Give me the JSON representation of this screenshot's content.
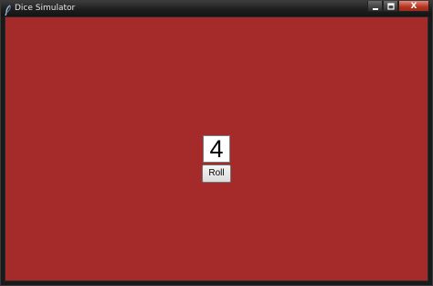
{
  "window": {
    "title": "Dice Simulator",
    "icon": "feather-icon",
    "controls": {
      "minimize_icon": "minimize-icon",
      "maximize_icon": "maximize-icon",
      "close_glyph": "X"
    }
  },
  "app": {
    "background_color": "#a52a2a",
    "die_value": "4",
    "roll_button_label": "Roll"
  }
}
